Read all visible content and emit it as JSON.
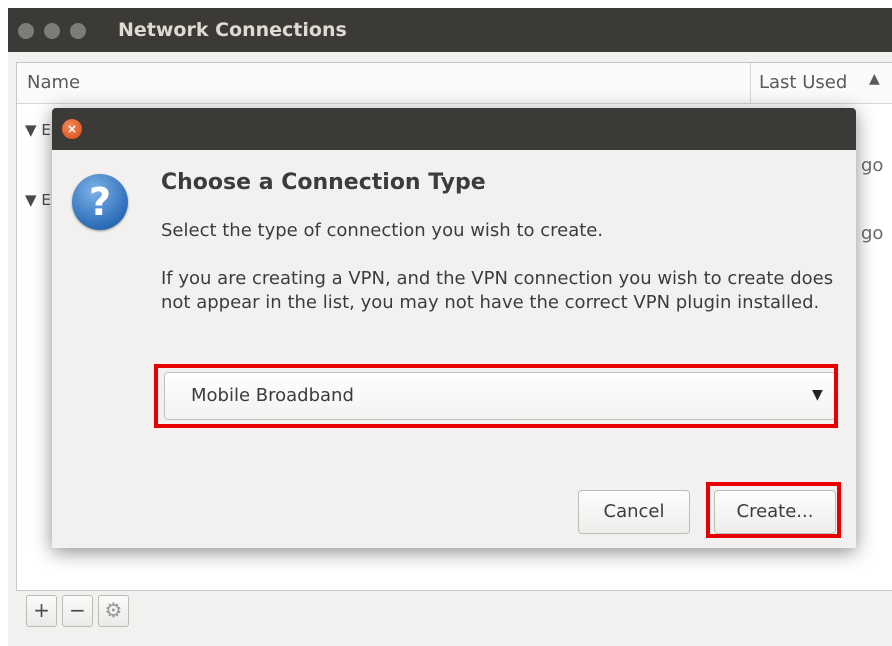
{
  "window": {
    "title": "Network Connections",
    "columns": {
      "name": "Name",
      "last_used": "Last Used"
    },
    "groups": [
      "E",
      "E"
    ],
    "rows_last_used_fragment": [
      "go",
      "go"
    ],
    "toolbar": {
      "add": "+",
      "remove": "−",
      "settings": "⚙"
    }
  },
  "dialog": {
    "close_glyph": "×",
    "icon_glyph": "?",
    "heading": "Choose a Connection Type",
    "subtitle": "Select the type of connection you wish to create.",
    "paragraph": "If you are creating a VPN, and the VPN connection you wish to create does not appear in the list, you may not have the correct VPN plugin installed.",
    "selected_type": "Mobile Broadband",
    "dropdown_arrow": "▼",
    "cancel_label": "Cancel",
    "create_label": "Create..."
  },
  "colors": {
    "highlight": "#e80000",
    "titlebar": "#3b3a36",
    "close": "#dd4814"
  }
}
